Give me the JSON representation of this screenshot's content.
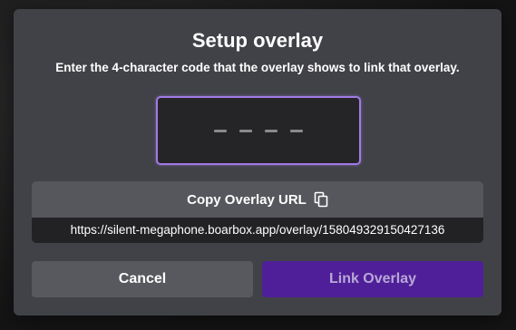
{
  "dialog": {
    "title": "Setup overlay",
    "subtitle": "Enter the 4-character code that the overlay shows to link that overlay.",
    "code_input": {
      "value": "",
      "slots": 4
    },
    "copy_url": {
      "label": "Copy Overlay URL",
      "icon": "copy-icon",
      "url": "https://silent-megaphone.boarbox.app/overlay/158049329150427136"
    },
    "buttons": {
      "cancel_label": "Cancel",
      "link_label": "Link Overlay"
    }
  },
  "colors": {
    "accent": "#a07ae6",
    "primary_button": "#4f1f99",
    "modal_bg": "#414247"
  }
}
